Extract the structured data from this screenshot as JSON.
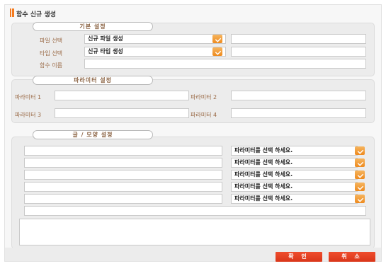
{
  "window": {
    "title": "함수 신규 생성"
  },
  "basic": {
    "legend": "기본 설정",
    "file_label": "파일 선택",
    "file_value": "신규 파일 생성",
    "file_extra": "",
    "type_label": "타입 선택",
    "type_value": "신규 타입 생성",
    "type_extra": "",
    "name_label": "함수 이름",
    "name_value": ""
  },
  "params": {
    "legend": "파라미터 설정",
    "p1_label": "파라미터 1",
    "p1_value": "",
    "p2_label": "파라미터 2",
    "p2_value": "",
    "p3_label": "파라미터 3",
    "p3_value": "",
    "p4_label": "파라미터 4",
    "p4_value": ""
  },
  "text_style": {
    "legend": "글 / 모양 설정",
    "rows": [
      {
        "text": "",
        "select": "파라미터를 선택 하세요."
      },
      {
        "text": "",
        "select": "파라미터를 선택 하세요."
      },
      {
        "text": "",
        "select": "파라미터를 선택 하세요."
      },
      {
        "text": "",
        "select": "파라미터를 선택 하세요."
      },
      {
        "text": "",
        "select": "파라미터를 선택 하세요."
      }
    ],
    "last_row": "",
    "preview": ""
  },
  "buttons": {
    "ok": "확 인",
    "cancel": "취 소"
  },
  "colors": {
    "accent": "#f5921e",
    "button": "#e0401f",
    "label": "#9a6a46"
  },
  "icons": {
    "dropdown": "dropdown-arrow-icon",
    "title_mark": "title-bar-icon"
  }
}
